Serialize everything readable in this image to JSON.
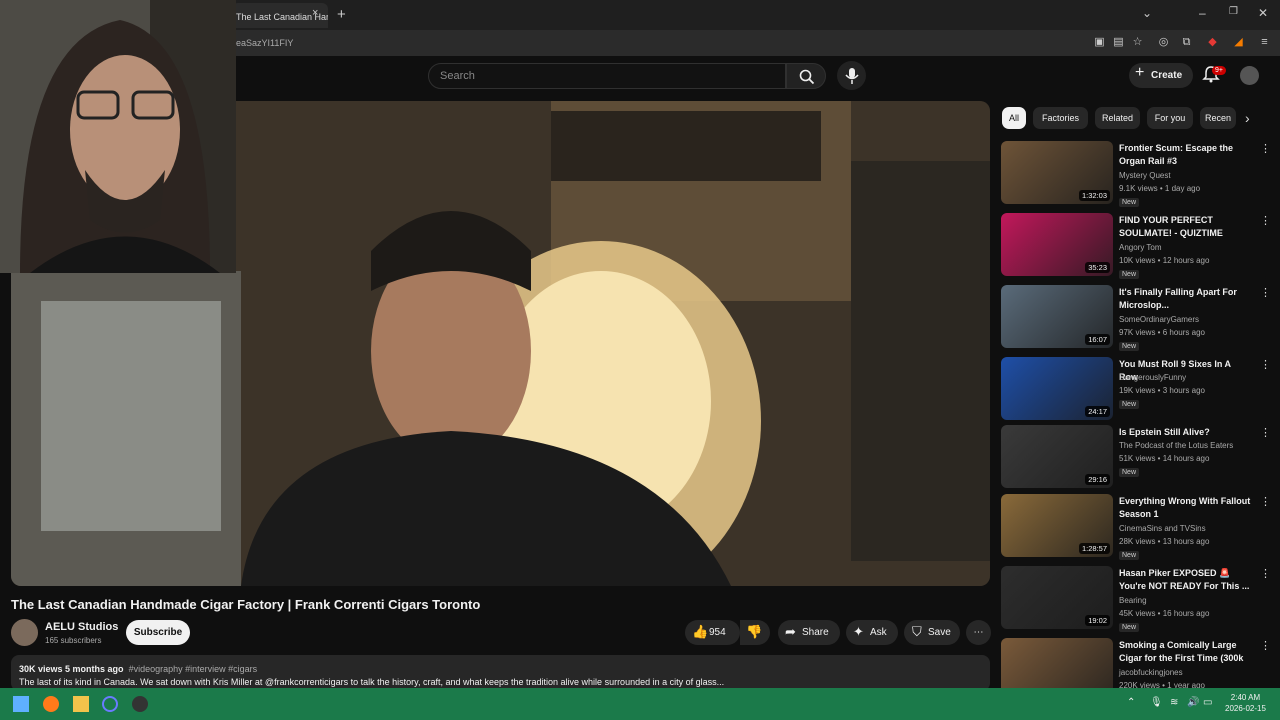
{
  "browser": {
    "tab_title": "The Last Canadian Han",
    "close_glyph": "×",
    "newtab_glyph": "+",
    "url_fragment": "eaSazYI11FIY"
  },
  "header": {
    "search_placeholder": "Search",
    "create_label": "Create",
    "notification_count": "9+"
  },
  "video": {
    "title": "The Last Canadian Handmade Cigar Factory | Frank Correnti Cigars Toronto",
    "channel": "AELU Studios",
    "subscribers": "165 subscribers",
    "subscribe_label": "Subscribe",
    "likes": "954",
    "share_label": "Share",
    "ask_label": "Ask",
    "save_label": "Save",
    "views_age": "30K views  5 months ago",
    "tags": "#videography #interview #cigars",
    "description": "The last of its kind in Canada. We sat down with Kris Miller at @frankcorrenticigars to talk the history, craft, and what keeps the tradition alive while surrounded in a city of glass..."
  },
  "chips": [
    "All",
    "Factories",
    "Related",
    "For you",
    "Recen"
  ],
  "recommendations": [
    {
      "title": "Frontier Scum: Escape the Organ Rail #3",
      "channel": "Mystery Quest",
      "meta": "9.1K views • 1 day ago",
      "duration": "1:32:03",
      "badge": "New",
      "color": "#6e5438"
    },
    {
      "title": "FIND YOUR PERFECT SOULMATE! - QUIZTIME",
      "channel": "Angory Tom",
      "meta": "10K views • 12 hours ago",
      "duration": "35:23",
      "badge": "New",
      "color": "#c2185b"
    },
    {
      "title": "It's Finally Falling Apart For Microslop...",
      "channel": "SomeOrdinaryGamers",
      "meta": "97K views • 6 hours ago",
      "duration": "16:07",
      "badge": "New",
      "color": "#5a6b7a"
    },
    {
      "title": "You Must Roll 9 Sixes In A Row",
      "channel": "DangerouslyFunny",
      "meta": "19K views • 3 hours ago",
      "duration": "24:17",
      "badge": "New",
      "color": "#1e4fa8"
    },
    {
      "title": "Is Epstein Still Alive?",
      "channel": "The Podcast of the Lotus Eaters",
      "meta": "51K views • 14 hours ago",
      "duration": "29:16",
      "badge": "New",
      "color": "#3a3a3a"
    },
    {
      "title": "Everything Wrong With Fallout Season 1",
      "channel": "CinemaSins  and TVSins",
      "meta": "28K views • 13 hours ago",
      "duration": "1:28:57",
      "badge": "New",
      "color": "#8a6a3a"
    },
    {
      "title": "Hasan Piker EXPOSED 🚨 You're NOT READY For This ...",
      "channel": "Bearing",
      "meta": "45K views • 16 hours ago",
      "duration": "19:02",
      "badge": "New",
      "color": "#2d2d2d"
    },
    {
      "title": "Smoking a Comically Large Cigar for the First Time (300k ...",
      "channel": "jacobfuckingjones",
      "meta": "220K views • 1 year ago",
      "duration": "",
      "badge": "",
      "color": "#7a5a3a"
    }
  ],
  "taskbar": {
    "time": "2:40 AM",
    "date": "2026-02-15"
  },
  "colors": {
    "taskbar": "#1b7a4a",
    "youtube_red": "#cc0000"
  }
}
